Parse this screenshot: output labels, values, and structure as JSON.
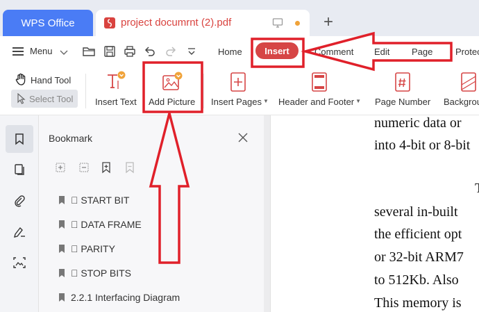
{
  "tabs": {
    "home_label": "WPS Office",
    "document_label": "project documrnt (2).pdf",
    "new_tab_label": "+"
  },
  "menu": {
    "menu_label": "Menu",
    "tabs": [
      {
        "label": "Home"
      },
      {
        "label": "Insert"
      },
      {
        "label": "Comment"
      },
      {
        "label": "Edit"
      },
      {
        "label": "Page"
      },
      {
        "label": "Protect"
      }
    ]
  },
  "ribbon": {
    "hand_tool_label": "Hand Tool",
    "select_tool_label": "Select Tool",
    "items": [
      {
        "label": "Insert Text",
        "icon": "insert-text-icon"
      },
      {
        "label": "Add Picture",
        "icon": "add-picture-icon"
      },
      {
        "label": "Insert Pages",
        "icon": "insert-pages-icon"
      },
      {
        "label": "Header and Footer",
        "icon": "header-footer-icon"
      },
      {
        "label": "Page Number",
        "icon": "page-number-icon"
      },
      {
        "label": "Background",
        "icon": "background-icon"
      }
    ]
  },
  "bookmark_panel": {
    "title": "Bookmark",
    "items": [
      {
        "label": "\u0000 START BIT"
      },
      {
        "label": "\u0000 DATA FRAME"
      },
      {
        "label": "\u0000 PARITY"
      },
      {
        "label": "\u0000 STOP BITS"
      },
      {
        "label": "2.2.1   Interfacing Diagram"
      }
    ]
  },
  "document": {
    "lines": [
      {
        "text": "numeric data or"
      },
      {
        "text": "into 4-bit or 8-bit"
      },
      {
        "text": "T"
      },
      {
        "text": "several in-built"
      },
      {
        "text": "the efficient opt"
      },
      {
        "text": "or 32-bit ARM7"
      },
      {
        "text": "to 512Kb. Also"
      },
      {
        "text": "This memory is"
      }
    ]
  },
  "colors": {
    "accent_blue": "#4a7cf5",
    "insert_red": "#d64545",
    "annotation_red": "#e0202a",
    "pdf_red": "#d9433f"
  }
}
